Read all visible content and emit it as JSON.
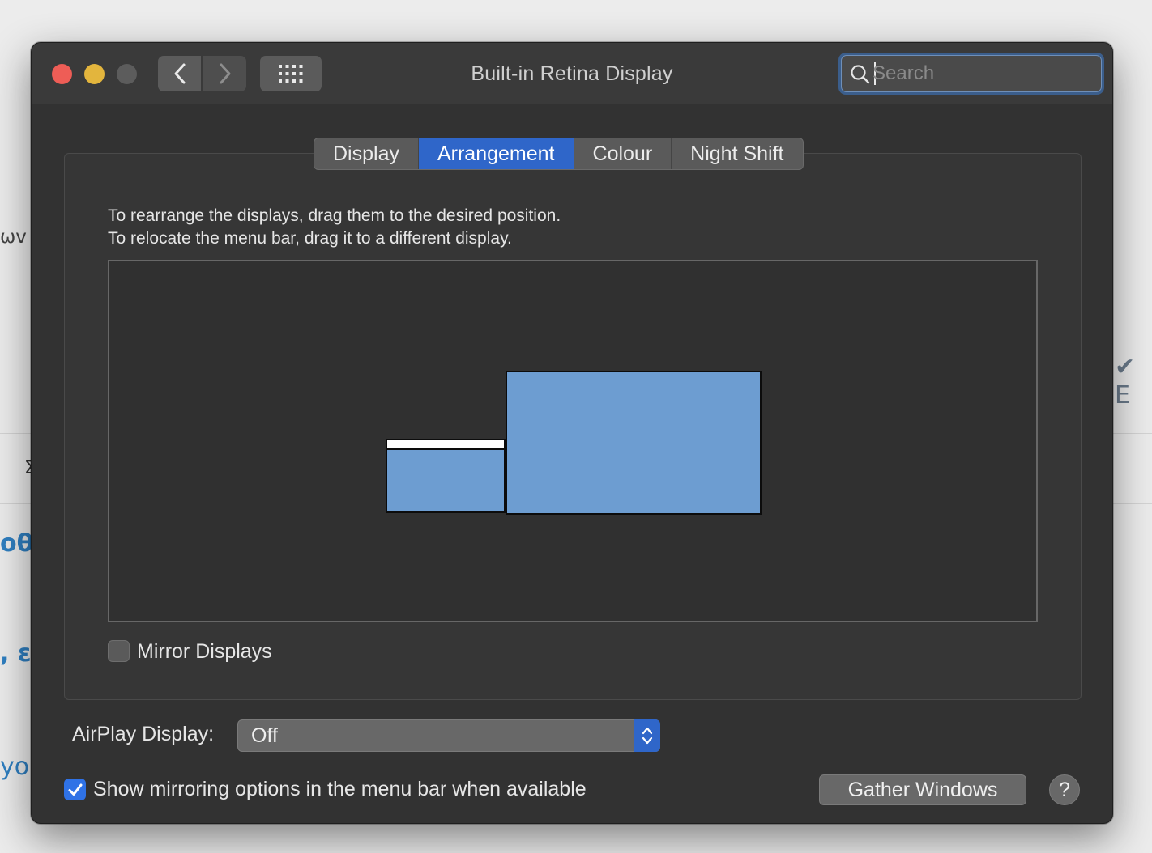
{
  "background": {
    "fragments": [
      "ωv",
      "Σ",
      "oθ",
      ", εν",
      "yoρ",
      "✔ E"
    ],
    "accent_color": "#2f7fc1"
  },
  "window": {
    "title": "Built-in Retina Display",
    "icons": {
      "back": "chevron-left-icon",
      "forward": "chevron-right-icon",
      "show_all": "grid-icon",
      "search": "magnifier-icon"
    },
    "search": {
      "placeholder": "Search",
      "value": ""
    }
  },
  "tabs": [
    {
      "label": "Display",
      "active": false
    },
    {
      "label": "Arrangement",
      "active": true
    },
    {
      "label": "Colour",
      "active": false
    },
    {
      "label": "Night Shift",
      "active": false
    }
  ],
  "arrangement": {
    "instructions_line1": "To rearrange the displays, drag them to the desired position.",
    "instructions_line2": "To relocate the menu bar, drag it to a different display.",
    "display_color": "#6d9dd1",
    "mirror_displays": {
      "label": "Mirror Displays",
      "checked": false
    }
  },
  "airplay": {
    "label": "AirPlay Display:",
    "selected": "Off"
  },
  "show_mirroring": {
    "label": "Show mirroring options in the menu bar when available",
    "checked": true
  },
  "buttons": {
    "gather_windows": "Gather Windows",
    "help": "?"
  },
  "colors": {
    "window_bg": "#323232",
    "accent": "#2f66c9",
    "close": "#ee5d56",
    "minimize": "#e3b53d",
    "zoom_disabled": "#5c5c5c"
  }
}
